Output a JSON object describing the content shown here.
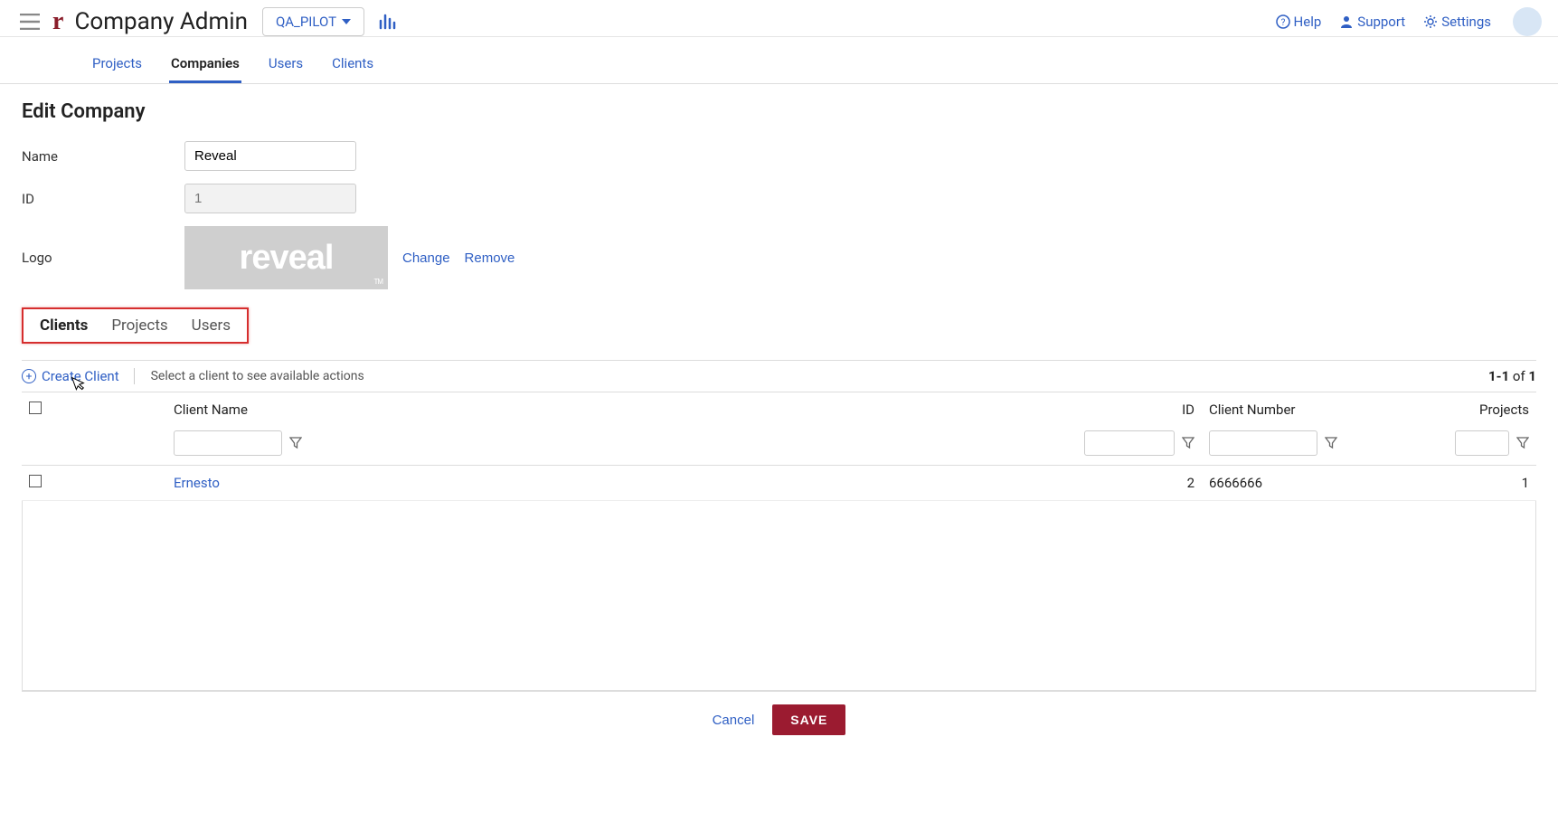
{
  "header": {
    "app_title": "Company Admin",
    "env_dropdown": "QA_PILOT",
    "help": "Help",
    "support": "Support",
    "settings": "Settings"
  },
  "nav": {
    "projects": "Projects",
    "companies": "Companies",
    "users": "Users",
    "clients": "Clients"
  },
  "page": {
    "title": "Edit Company",
    "name_label": "Name",
    "name_value": "Reveal",
    "id_label": "ID",
    "id_value": "1",
    "logo_label": "Logo",
    "logo_text": "reveal",
    "change": "Change",
    "remove": "Remove"
  },
  "subtabs": {
    "clients": "Clients",
    "projects": "Projects",
    "users": "Users"
  },
  "actionbar": {
    "create_client": "Create Client",
    "hint": "Select a client to see available actions",
    "pager_range": "1-1",
    "pager_of": " of ",
    "pager_total": "1"
  },
  "table": {
    "headers": {
      "client_name": "Client Name",
      "id": "ID",
      "client_number": "Client Number",
      "projects": "Projects"
    },
    "rows": [
      {
        "client_name": "Ernesto",
        "id": "2",
        "client_number": "6666666",
        "projects": "1"
      }
    ]
  },
  "footer": {
    "cancel": "Cancel",
    "save": "SAVE"
  }
}
